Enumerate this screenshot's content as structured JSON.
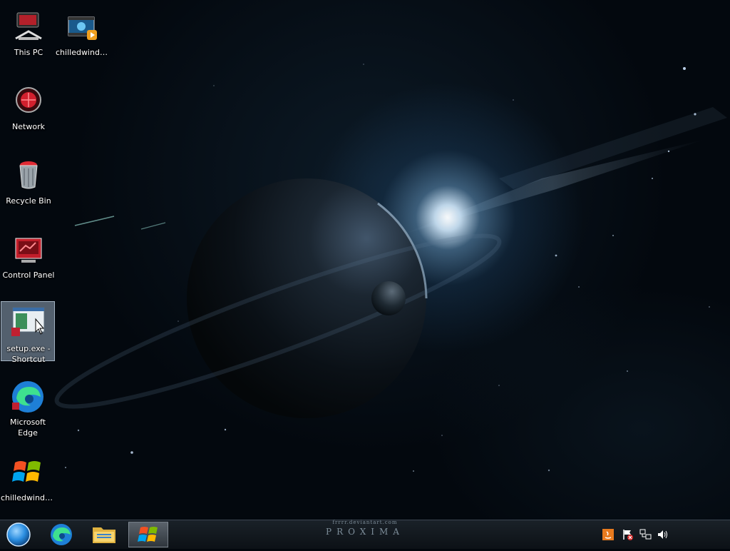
{
  "desktop": {
    "icons": [
      {
        "label": "This PC"
      },
      {
        "label": "chilledwindo..."
      },
      {
        "label": "Network"
      },
      {
        "label": "Recycle Bin"
      },
      {
        "label": "Control Panel"
      },
      {
        "label": "setup.exe - Shortcut"
      },
      {
        "label": "Microsoft Edge"
      },
      {
        "label": "chilledwindo..."
      }
    ],
    "wallpaper_credit": "frrrr.deviantart.com",
    "wallpaper_title": "PROXIMA"
  },
  "taskbar": {
    "buttons": [
      "start-orb",
      "edge-icon",
      "file-explorer-icon",
      "windows-logo-icon"
    ],
    "tray": [
      "java-update-icon",
      "action-center-flag-icon",
      "network-icon",
      "volume-icon"
    ]
  },
  "colors": {
    "selection": "#8fa3b6",
    "taskbar": "#10161c"
  }
}
